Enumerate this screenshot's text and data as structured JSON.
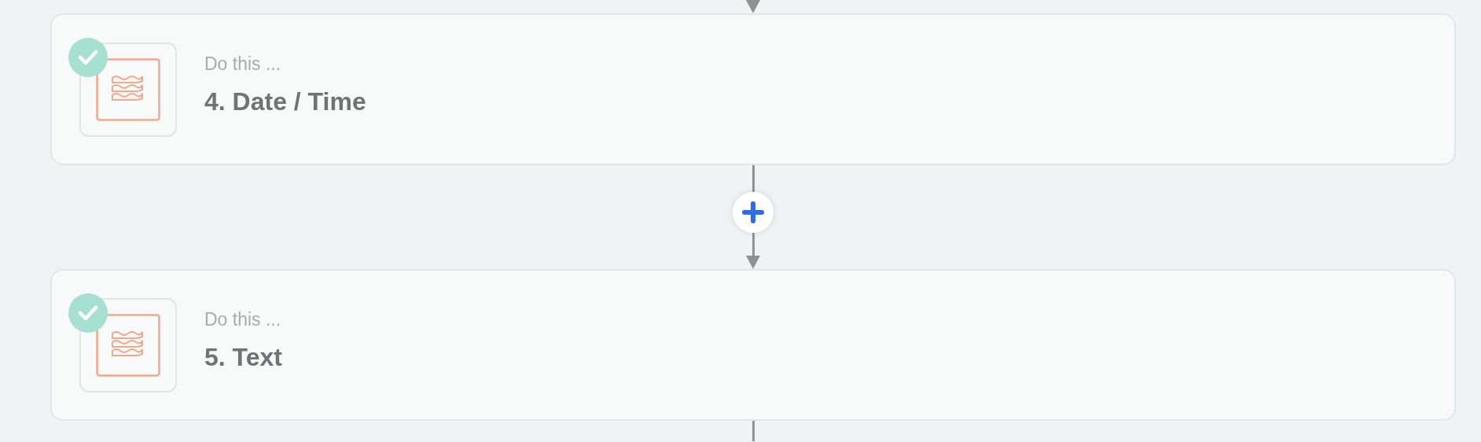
{
  "steps": [
    {
      "label": "Do this ...",
      "title": "4. Date / Time",
      "completed": true
    },
    {
      "label": "Do this ...",
      "title": "5. Text",
      "completed": true
    }
  ]
}
